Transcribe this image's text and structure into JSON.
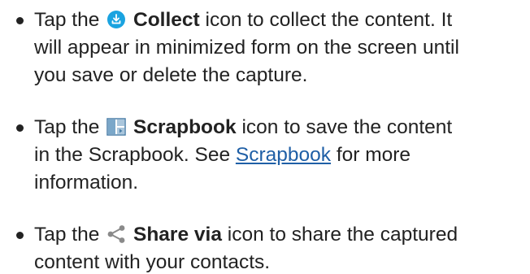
{
  "items": [
    {
      "prefix": "Tap the",
      "icon": "collect-icon",
      "bold_label": "Collect",
      "line1_rest": "icon to collect the content. It",
      "line2": "will appear in minimized form on the screen until",
      "line3": "you save or delete the capture."
    },
    {
      "prefix": "Tap the",
      "icon": "scrapbook-icon",
      "bold_label": "Scrapbook",
      "line1_rest": "icon to save the content",
      "line2_pre": "in the Scrapbook. See",
      "link_text": "Scrapbook",
      "line2_post": "for more",
      "line3": "information."
    },
    {
      "prefix": "Tap the",
      "icon": "share-icon",
      "bold_label": "Share via",
      "line1_rest": "icon to share the captured",
      "line2": "content with your contacts."
    }
  ],
  "colors": {
    "text": "#222222",
    "link": "#1f5fa6",
    "collect_icon": "#1aa3e0",
    "scrapbook_icon": "#4a7fa8",
    "share_icon": "#8a8a8a"
  }
}
